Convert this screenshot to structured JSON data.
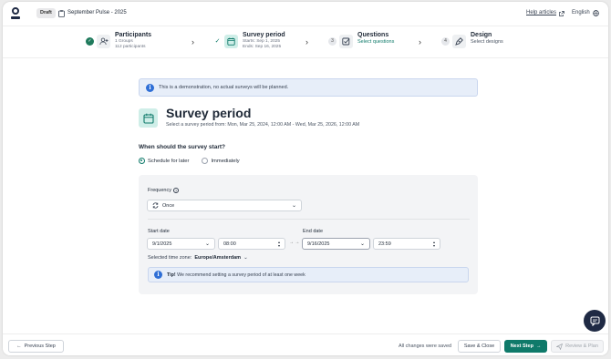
{
  "header": {
    "badge": "Draft",
    "survey_name": "September Pulse - 2025",
    "help_link": "Help articles",
    "language": "English"
  },
  "stepper": {
    "steps": [
      {
        "title": "Participants",
        "line1": "1 Groups",
        "line2": "112 participants",
        "status": "done"
      },
      {
        "title": "Survey period",
        "line1": "Starts: Sep 1, 2025",
        "line2": "Ends: Sep 16, 2025",
        "status": "active"
      },
      {
        "title": "Questions",
        "line1": "Select questions",
        "number": "3"
      },
      {
        "title": "Design",
        "line1": "Select designs",
        "number": "4"
      }
    ]
  },
  "notice": {
    "text": "This is a demonstration, no actual surveys will be planned."
  },
  "main": {
    "title": "Survey period",
    "subtitle": "Select a survey period from: Mon, Mar 25, 2024, 12:00 AM - Wed, Mar 25, 2026, 12:00 AM",
    "question": "When should the survey start?",
    "options": [
      "Schedule for later",
      "Immediately"
    ],
    "selected_option": "Schedule for later"
  },
  "schedule": {
    "frequency_label": "Frequency",
    "frequency_value": "Once",
    "start_date_label": "Start date",
    "start_date": "9/1/2025",
    "start_time": "08:00",
    "range_sep": "→ →",
    "end_date_label": "End date",
    "end_date": "9/16/2025",
    "end_time": "23:59",
    "timezone_label": "Selected time zone:",
    "timezone_value": "Europe/Amsterdam",
    "tip_bold": "Tip!",
    "tip_text": "We recommend setting a survey period of at least one week"
  },
  "footer": {
    "previous": "Previous Step",
    "saved_status": "All changes were saved",
    "save_close": "Save & Close",
    "next": "Next Step",
    "review": "Review & Plan"
  },
  "colors": {
    "accent": "#0f7a6a",
    "accent_light": "#cfeee8",
    "info_bg": "#e7eef9",
    "info_icon": "#2f6fd6",
    "chat_bg": "#1f2a44"
  }
}
